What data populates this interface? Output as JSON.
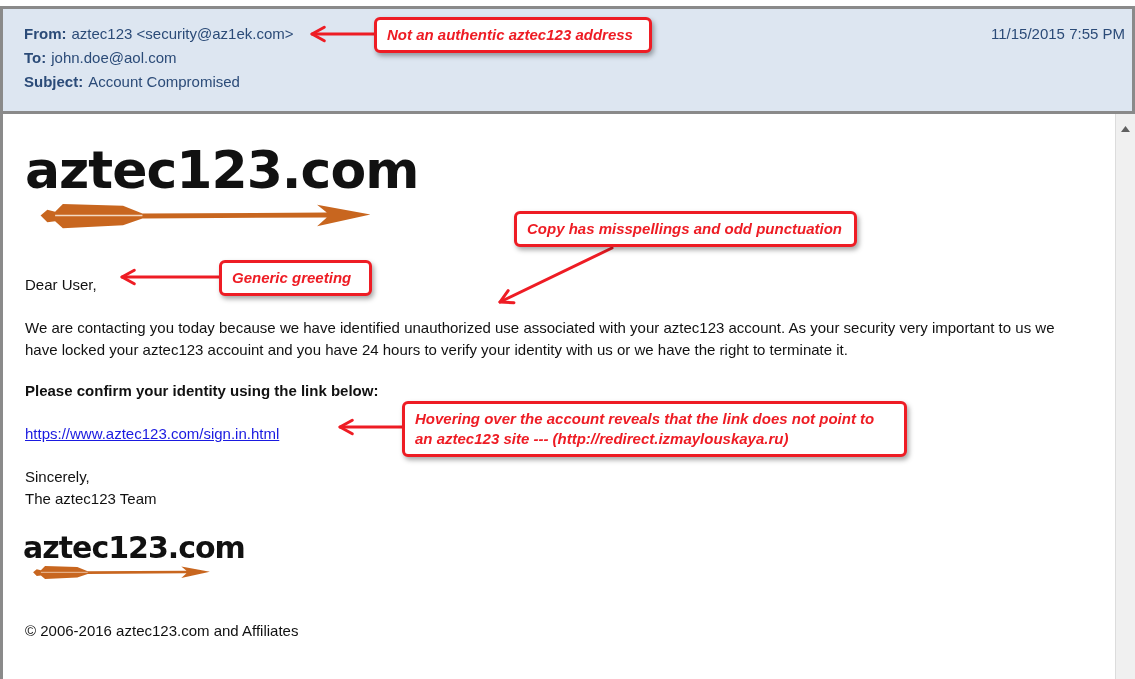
{
  "header": {
    "from": {
      "label": "From:",
      "value": "aztec123 <security@az1ek.com>"
    },
    "to": {
      "label": "To:",
      "value": "john.doe@aol.com"
    },
    "subject": {
      "label": "Subject:",
      "value": "Account Compromised"
    },
    "date": "11/15/2015 7:55 PM"
  },
  "body": {
    "logo": "aztec123.com",
    "greeting": "Dear User,",
    "paragraph": "We are contacting you today because we have identified unauthorized use associated with your aztec123 account. As your security very important to us we have locked your aztec123 accouint and you have 24 hours to verify your identity with us or we have the right to terminate it.",
    "call_to_action": "Please confirm your identity using the link below:",
    "link": "https://www.aztec123.com/sign.in.html",
    "closing": [
      "Sincerely,",
      "The aztec123 Team"
    ],
    "footer_logo": "aztec123.com",
    "copyright": "© 2006-2016 aztec123.com and Affiliates"
  },
  "annotations": [
    {
      "text": "Not an authentic aztec123 address"
    },
    {
      "text": "Copy has misspellings and odd punctuation"
    },
    {
      "text": "Generic greeting"
    },
    {
      "text": "Hovering over the account reveals that the link does not point to an aztec123 site --- (http://redirect.izmaylouskaya.ru)"
    }
  ]
}
